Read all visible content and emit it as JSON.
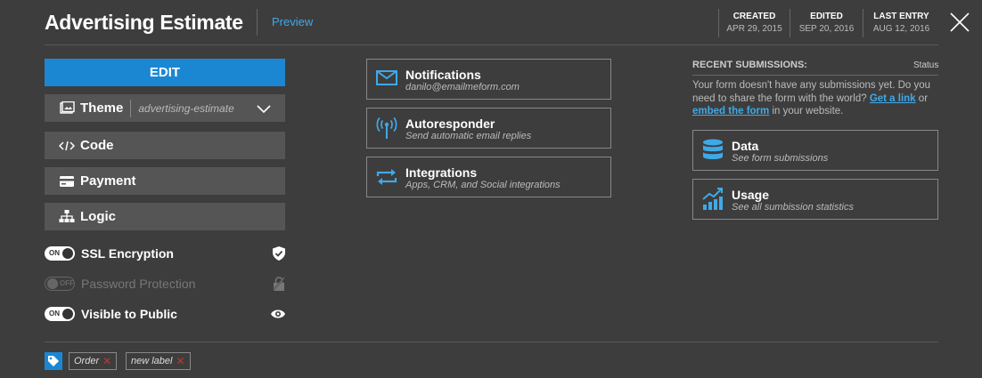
{
  "header": {
    "title": "Advertising Estimate",
    "preview_label": "Preview",
    "meta": [
      {
        "label": "CREATED",
        "value": "APR 29, 2015"
      },
      {
        "label": "EDITED",
        "value": "SEP 20, 2016"
      },
      {
        "label": "LAST ENTRY",
        "value": "AUG 12, 2016"
      }
    ],
    "close_icon": "close-icon"
  },
  "left": {
    "edit_label": "EDIT",
    "theme": {
      "label": "Theme",
      "value": "advertising-estimate",
      "icon": "image-icon"
    },
    "code": {
      "label": "Code",
      "icon": "code-icon"
    },
    "payment": {
      "label": "Payment",
      "icon": "credit-card-icon"
    },
    "logic": {
      "label": "Logic",
      "icon": "sitemap-icon"
    },
    "toggles": [
      {
        "label": "SSL Encryption",
        "state": "ON",
        "icon": "shield-check-icon"
      },
      {
        "label": "Password Protection",
        "state": "OFF",
        "icon": "lock-disabled-icon"
      },
      {
        "label": "Visible to Public",
        "state": "ON",
        "icon": "eye-icon"
      }
    ]
  },
  "middle": {
    "cards": [
      {
        "title": "Notifications",
        "subtitle": "danilo@emailmeform.com",
        "icon": "envelope-icon"
      },
      {
        "title": "Autoresponder",
        "subtitle": "Send automatic email replies",
        "icon": "broadcast-icon"
      },
      {
        "title": "Integrations",
        "subtitle": "Apps, CRM, and Social integrations",
        "icon": "sync-arrows-icon"
      }
    ]
  },
  "right": {
    "recent_title": "RECENT SUBMISSIONS:",
    "status_label": "Status",
    "message_pre": "Your form doesn't have any submissions yet. Do you need to share the form with the world?",
    "link_get": "Get a link",
    "message_or": "or",
    "link_embed": "embed the form",
    "message_post": "in your website.",
    "cards": [
      {
        "title": "Data",
        "subtitle": "See form submissions",
        "icon": "database-icon"
      },
      {
        "title": "Usage",
        "subtitle": "See all sumbission statistics",
        "icon": "chart-icon"
      }
    ]
  },
  "footer": {
    "tags": [
      "Order",
      "new label"
    ]
  },
  "colors": {
    "accent": "#1b87d3",
    "link": "#3fa9e8",
    "background": "#3d3d3d",
    "button": "#555555",
    "tag_remove": "#c0392b"
  }
}
